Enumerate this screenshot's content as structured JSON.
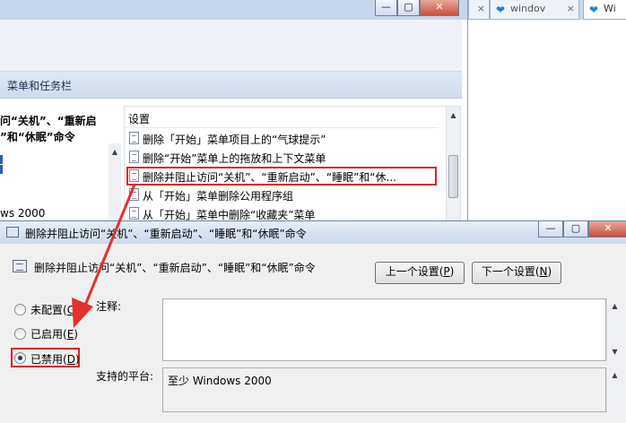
{
  "browser": {
    "tabs": [
      {
        "label": "...",
        "style": "blurred"
      },
      {
        "label": "...",
        "style": "blurred"
      },
      {
        "label": "...",
        "style": "blurred"
      },
      {
        "label": "...",
        "style": "blurred"
      },
      {
        "label": "windov",
        "style": "normal"
      },
      {
        "label": "Wi",
        "style": "active"
      }
    ],
    "close_glyph": "×"
  },
  "bg_window": {
    "title_buttons": [
      "—",
      "▢",
      "✕"
    ],
    "header": "菜单和任务栏",
    "left_panel": {
      "lines": [
        "问“关机”、“重新启",
        "”和“休眠”命令",
        "ws 2000"
      ]
    },
    "list": {
      "column_header": "设置",
      "rows": [
        "删除「开始」菜单项目上的“气球提示”",
        "删除“开始”菜单上的拖放和上下文菜单",
        "删除并阻止访问“关机”、“重新启动”、“睡眠”和“休...",
        "从「开始」菜单删除公用程序组",
        "从「开始」菜单中删除“收藏夹”菜单"
      ]
    }
  },
  "dialog": {
    "title": "删除并阻止访问“关机”、“重新启动”、“睡眠”和“休眠”命令",
    "title_buttons": [
      "—",
      "▢",
      "✕"
    ],
    "policy_name": "删除并阻止访问“关机”、“重新启动”、“睡眠”和“休眠”命令",
    "prev_button": {
      "text": "上一个设置(",
      "key": "P",
      "end": ")"
    },
    "next_button": {
      "text": "下一个设置(",
      "key": "N",
      "end": ")"
    },
    "radios": [
      {
        "text": "未配置(",
        "key": "C",
        "end": ")",
        "selected": false,
        "highlight": false
      },
      {
        "text": "已启用(",
        "key": "E",
        "end": ")",
        "selected": false,
        "highlight": false
      },
      {
        "text": "已禁用(",
        "key": "D",
        "end": ")",
        "selected": true,
        "highlight": true
      }
    ],
    "comment_label": "注释:",
    "platform_label": "支持的平台:",
    "platform_value": "至少 Windows 2000"
  },
  "colors": {
    "highlight_red": "#e02020",
    "arrow_red": "#e53030"
  }
}
